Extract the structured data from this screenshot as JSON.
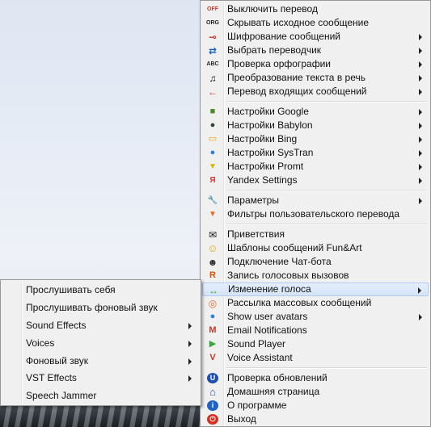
{
  "main_menu": {
    "groups": [
      [
        {
          "label": "Выключить перевод",
          "icon": "off-icon",
          "glyph": "OFF",
          "submenu": false
        },
        {
          "label": "Скрывать исходное сообщение",
          "icon": "org-icon",
          "glyph": "ORG",
          "submenu": false
        },
        {
          "label": "Шифрование сообщений",
          "icon": "key-icon",
          "glyph": "⊸",
          "submenu": true
        },
        {
          "label": "Выбрать переводчик",
          "icon": "swap-icon",
          "glyph": "⇄",
          "submenu": true
        },
        {
          "label": "Проверка орфографии",
          "icon": "abc-icon",
          "glyph": "ABC",
          "submenu": true
        },
        {
          "label": "Преобразование текста в речь",
          "icon": "music-note-icon",
          "glyph": "♫",
          "submenu": true
        },
        {
          "label": "Перевод входящих сообщений",
          "icon": "arrow-left-icon",
          "glyph": "←",
          "submenu": true
        }
      ],
      [
        {
          "label": "Настройки Google",
          "icon": "google-icon",
          "glyph": "■",
          "submenu": true
        },
        {
          "label": "Настройки Babylon",
          "icon": "babylon-icon",
          "glyph": "●",
          "submenu": true
        },
        {
          "label": "Настройки Bing",
          "icon": "bing-icon",
          "glyph": "▭",
          "submenu": true
        },
        {
          "label": "Настройки SysTran",
          "icon": "systran-icon",
          "glyph": "●",
          "submenu": true
        },
        {
          "label": "Настройки Promt",
          "icon": "promt-icon",
          "glyph": "▼",
          "submenu": true
        },
        {
          "label": "Yandex Settings",
          "icon": "yandex-icon",
          "glyph": "Я",
          "submenu": true
        }
      ],
      [
        {
          "label": "Параметры",
          "icon": "wrench-icon",
          "glyph": "🔧",
          "submenu": true
        },
        {
          "label": "Фильтры пользовательского перевода",
          "icon": "filter-icon",
          "glyph": "▼",
          "submenu": false
        }
      ],
      [
        {
          "label": "Приветствия",
          "icon": "envelope-icon",
          "glyph": "✉",
          "submenu": false
        },
        {
          "label": "Шаблоны сообщений Fun&Art",
          "icon": "smiley-icon",
          "glyph": "☺",
          "submenu": false
        },
        {
          "label": "Подключение Чат-бота",
          "icon": "robot-icon",
          "glyph": "☻",
          "submenu": false
        },
        {
          "label": "Запись голосовых вызовов",
          "icon": "record-icon",
          "glyph": "R",
          "submenu": false
        },
        {
          "label": "Изменение голоса",
          "icon": "voice-change-icon",
          "glyph": "↔",
          "submenu": true,
          "highlighted": true
        },
        {
          "label": "Рассылка массовых сообщений",
          "icon": "broadcast-icon",
          "glyph": "◎",
          "submenu": false
        },
        {
          "label": "Show user avatars",
          "icon": "avatar-icon",
          "glyph": "●",
          "submenu": true
        },
        {
          "label": "Email Notifications",
          "icon": "gmail-icon",
          "glyph": "M",
          "submenu": false
        },
        {
          "label": "Sound Player",
          "icon": "play-icon",
          "glyph": "▶",
          "submenu": false
        },
        {
          "label": " Voice Assistant",
          "icon": "voice-assistant-icon",
          "glyph": "V",
          "submenu": false
        }
      ],
      [
        {
          "label": "Проверка обновлений",
          "icon": "update-icon",
          "glyph": "U",
          "submenu": false
        },
        {
          "label": "Домашняя страница",
          "icon": "home-icon",
          "glyph": "⌂",
          "submenu": false
        },
        {
          "label": "О программе",
          "icon": "info-icon",
          "glyph": "i",
          "submenu": false
        },
        {
          "label": "Выход",
          "icon": "power-icon",
          "glyph": "⏻",
          "submenu": false
        }
      ]
    ]
  },
  "sub_menu": {
    "items": [
      {
        "label": "Прослушивать себя",
        "submenu": false
      },
      {
        "label": "Прослушивать фоновый звук",
        "submenu": false
      },
      {
        "label": "Sound Effects",
        "submenu": true
      },
      {
        "label": "Voices",
        "submenu": true
      },
      {
        "label": "Фоновый звук",
        "submenu": true
      },
      {
        "label": "VST Effects",
        "submenu": true
      },
      {
        "label": "Speech Jammer",
        "submenu": false
      }
    ]
  },
  "colors": {
    "highlight_bg": "#d5e4f9",
    "highlight_border": "#aecbf0",
    "menu_bg": "#f0f0f0"
  }
}
